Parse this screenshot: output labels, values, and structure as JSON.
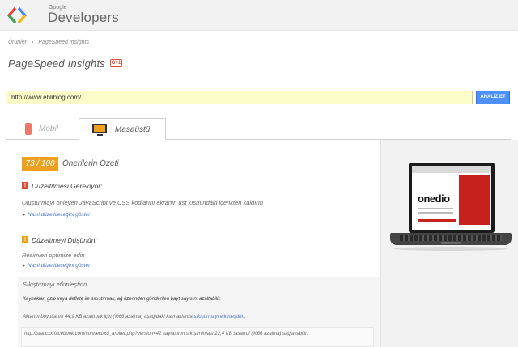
{
  "header": {
    "logo_small": "Google",
    "logo_big": "Developers",
    "brand_colors": [
      "#4285f4",
      "#ea4335",
      "#fbbc05",
      "#34a853"
    ]
  },
  "breadcrumb": {
    "items": [
      "Ürünler",
      "PageSpeed Insights"
    ],
    "separator": "›"
  },
  "page": {
    "title": "PageSpeed Insights",
    "gplus_label": "G+1"
  },
  "search": {
    "url_value": "http://www.ehliblog.com/",
    "analyze_label": "ANALİZ ET"
  },
  "tabs": [
    {
      "label": "Mobil",
      "icon": "mobile-phone-icon",
      "active": false
    },
    {
      "label": "Masaüstü",
      "icon": "desktop-monitor-icon",
      "active": true
    }
  ],
  "score": {
    "value": "73 / 100",
    "title": "Önerilerin Özeti",
    "color": "#f0a01f"
  },
  "sections": {
    "must_fix": {
      "icon": "exclamation-red-icon",
      "title": "Düzeltilmesi Gerekiyor:",
      "desc": "Oluşturmayı önleyen JavaScript ve CSS kodlarını ekranın üst kısmındaki içerikten kaldırın",
      "link": "Nasıl düzeltileceğini göster"
    },
    "consider_fix": {
      "icon": "exclamation-orange-icon",
      "title": "Düzeltmeyi Düşünün:",
      "desc": "Resimleri optimize edin",
      "link": "Nasıl düzeltileceğini göster"
    }
  },
  "detail": {
    "title": "Sıkıştırmayı etkinleştirin",
    "line1": "Kaynakları gzip veya deflate ile sıkıştırmak, ağ üzerinden gönderilen bayt sayısını azaltabilir.",
    "line2_prefix": "Aktarım boyutlarını 44,9 KB azaltmak için (%66 azalma) aşağıdaki kaynaklarda ",
    "line2_link": "sıkıştırmayı etkinleştirin",
    "line2_suffix": ".",
    "line3": "http://staticxx.facebook.com/connect/xd_arbiter.php?version=42 sayfasının sıkıştırılması 22,4 KB tasarruf (%66 azalma) sağlayabilir."
  },
  "preview": {
    "site_brand": "onedio",
    "brand_color": "#c7211d"
  }
}
